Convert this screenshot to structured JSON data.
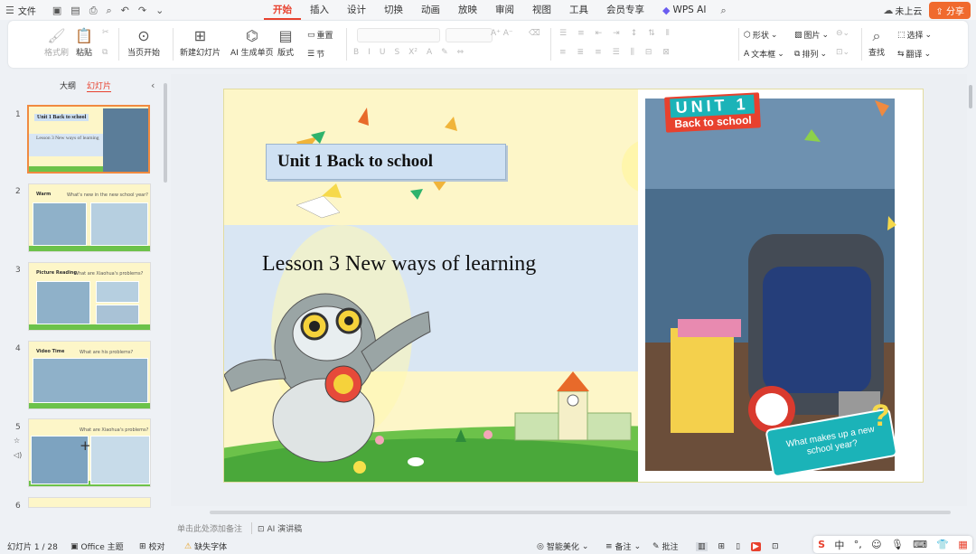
{
  "menubar": {
    "file_label": "文件",
    "tabs": [
      "开始",
      "插入",
      "设计",
      "切换",
      "动画",
      "放映",
      "审阅",
      "视图",
      "工具",
      "会员专享",
      "WPS AI"
    ],
    "active_tab": "开始",
    "cloud_label": "未上云",
    "share_label": "分享"
  },
  "ribbon": {
    "format_painter": "格式刷",
    "paste": "粘贴",
    "from_current": "当页开始",
    "new_slide": "新建幻灯片",
    "ai_page": "AI 生成单页",
    "layout": "版式",
    "reset": "重置",
    "section": "节",
    "shape": "形状",
    "picture": "图片",
    "textbox": "文本框",
    "arrange": "排列",
    "find": "查找",
    "select": "选择",
    "translate": "翻译"
  },
  "left_pane": {
    "outline_tab": "大纲",
    "slides_tab": "幻灯片",
    "slides": [
      {
        "num": "1",
        "title": "Unit 1 Back to school",
        "sub": "Lesson 3 New ways of learning"
      },
      {
        "num": "2",
        "title": "Warm",
        "sub": "What's new in the new school year?"
      },
      {
        "num": "3",
        "title": "Picture Reading",
        "sub": "What are Xiaohua's problems?"
      },
      {
        "num": "4",
        "title": "Video Time",
        "sub": "What are his problems?"
      },
      {
        "num": "5",
        "title": "",
        "sub": "What are Xiaohua's problems?"
      },
      {
        "num": "6",
        "title": "",
        "sub": ""
      }
    ]
  },
  "slide": {
    "title": "Unit 1 Back to school",
    "lesson": "Lesson 3 New ways of learning",
    "badge_unit": "UNIT 1",
    "badge_sub": "Back to school",
    "bubble": "What makes up a new school year?"
  },
  "notes": {
    "placeholder": "单击此处添加备注",
    "ai_speech": "AI 演讲稿"
  },
  "status": {
    "slide_count": "幻灯片 1 / 28",
    "theme": "Office 主题",
    "proof": "校对",
    "missing_font": "缺失字体",
    "beautify": "智能美化",
    "notes": "备注",
    "comments": "批注"
  },
  "ime": {
    "logo": "S",
    "lang": "中"
  },
  "colors": {
    "accent": "#e8412e",
    "share": "#f06a2e",
    "slide_bg": "#fdf6c8",
    "title_box": "#cfe1f3",
    "bubble": "#1bb3b8"
  }
}
